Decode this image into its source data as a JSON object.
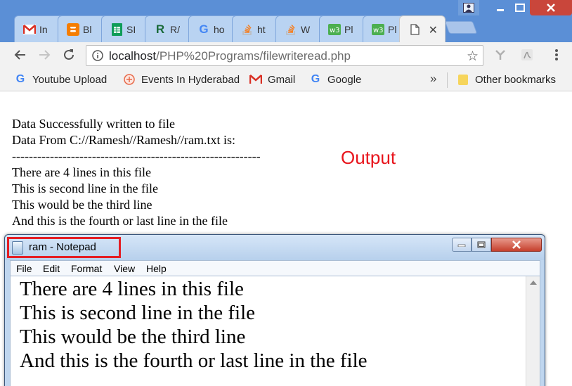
{
  "browser": {
    "tabs": [
      {
        "label": "In",
        "icon": "gmail-icon"
      },
      {
        "label": "Bl",
        "icon": "blogger-icon"
      },
      {
        "label": "SI",
        "icon": "sheets-icon"
      },
      {
        "label": "R/",
        "icon": "r-icon"
      },
      {
        "label": "ho",
        "icon": "google-icon"
      },
      {
        "label": "ht",
        "icon": "stackoverflow-icon"
      },
      {
        "label": "W",
        "icon": "stackoverflow-icon"
      },
      {
        "label": "Pl",
        "icon": "w3schools-icon"
      },
      {
        "label": "Pl",
        "icon": "w3schools-icon"
      },
      {
        "label": "",
        "icon": "page-icon",
        "active": true
      }
    ],
    "url_host": "localhost",
    "url_path": "/PHP%20Programs/filewriteread.php",
    "bookmarks": [
      {
        "label": "Youtube Upload",
        "icon": "google-icon"
      },
      {
        "label": "Events In Hyderabad",
        "icon": "events-icon"
      },
      {
        "label": "Gmail",
        "icon": "gmail-icon"
      },
      {
        "label": "Google",
        "icon": "google-icon"
      }
    ],
    "more_bookmarks": "»",
    "other_bookmarks": "Other bookmarks"
  },
  "page": {
    "lines": [
      "Data Successfully written to file",
      "Data From C://Ramesh//Ramesh//ram.txt is:",
      "-----------------------------------------------------------",
      "There are 4 lines in this file",
      "This is second line in the file",
      "This would be the third line",
      "And this is the fourth or last line in the file"
    ],
    "output_label": "Output"
  },
  "notepad": {
    "title": "ram - Notepad",
    "menu": [
      "File",
      "Edit",
      "Format",
      "View",
      "Help"
    ],
    "lines": [
      "There are 4 lines in this file",
      "This is second line in the file",
      "This would be the third line",
      "And this is the fourth or last line in the file"
    ]
  },
  "colors": {
    "titlebar": "#5b8fd6",
    "output_label": "#e8141c",
    "highlight_box": "#e41e24"
  }
}
